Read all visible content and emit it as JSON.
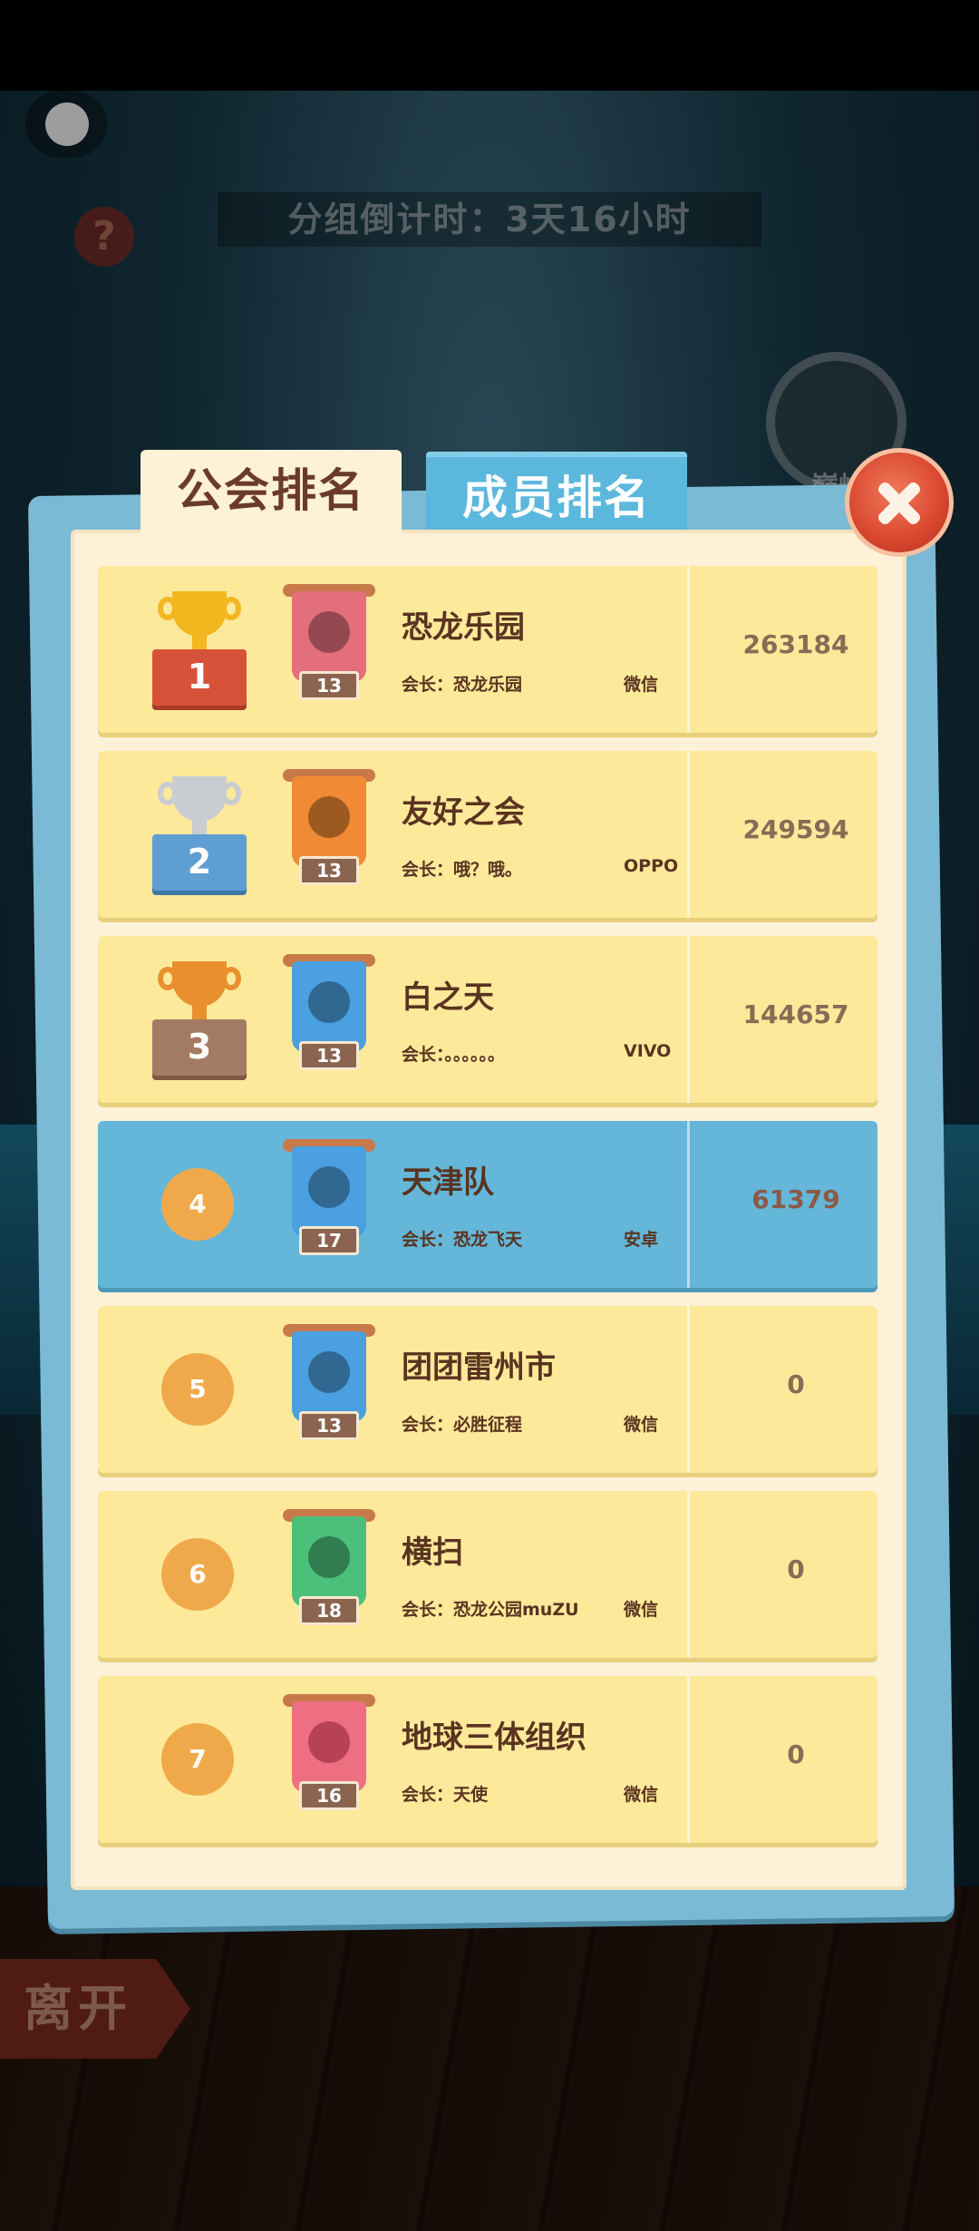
{
  "header": {
    "countdown": "分组倒计时：3天16小时",
    "help_icon": "?",
    "peak_label": "巅峰"
  },
  "tabs": [
    {
      "label": "公会排名",
      "active": true
    },
    {
      "label": "成员排名",
      "active": false
    }
  ],
  "close_icon": "close-icon",
  "leave_label": "离开",
  "rows": [
    {
      "rank": "1",
      "name": "恐龙乐园",
      "level": "13",
      "leader": "会长：恐龙乐园",
      "platform": "微信",
      "score": "263184",
      "banner_color": "red",
      "icon": "dragon-icon"
    },
    {
      "rank": "2",
      "name": "友好之会",
      "level": "13",
      "leader": "会长：哦？哦。",
      "platform": "OPPO",
      "score": "249594",
      "banner_color": "orange",
      "icon": "wolf-icon"
    },
    {
      "rank": "3",
      "name": "白之天",
      "level": "13",
      "leader": "会长：。。。。。。",
      "platform": "VIVO",
      "score": "144657",
      "banner_color": "blue",
      "icon": "wolf-icon"
    },
    {
      "rank": "4",
      "name": "天津队",
      "level": "17",
      "leader": "会长：恐龙飞天",
      "platform": "安卓",
      "score": "61379",
      "banner_color": "blue",
      "icon": "wolf-icon"
    },
    {
      "rank": "5",
      "name": "团团雷州市",
      "level": "13",
      "leader": "会长：必胜征程",
      "platform": "微信",
      "score": "0",
      "banner_color": "blue",
      "icon": "wolf-icon"
    },
    {
      "rank": "6",
      "name": "横扫",
      "level": "18",
      "leader": "会长：恐龙公园muZU",
      "platform": "微信",
      "score": "0",
      "banner_color": "green",
      "icon": "dragon-icon"
    },
    {
      "rank": "7",
      "name": "地球三体组织",
      "level": "16",
      "leader": "会长：天使",
      "platform": "微信",
      "score": "0",
      "banner_color": "pink",
      "icon": "moon-icon"
    }
  ]
}
